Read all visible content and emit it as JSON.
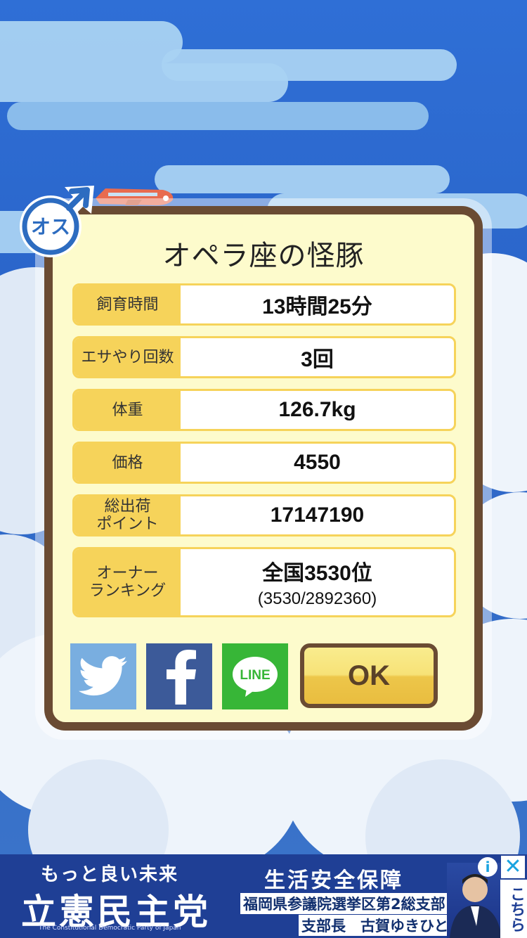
{
  "dialog": {
    "title": "オペラ座の怪豚",
    "rows": [
      {
        "label": "飼育時間",
        "value": "13時間25分"
      },
      {
        "label": "エサやり回数",
        "value": "3回"
      },
      {
        "label": "体重",
        "value": "126.7kg"
      },
      {
        "label": "価格",
        "value": "4550"
      },
      {
        "label": "総出荷\nポイント",
        "value": "17147190"
      },
      {
        "label": "オーナー\nランキング",
        "value": "全国3530位",
        "sub": "(3530/2892360)"
      }
    ],
    "ok_label": "OK",
    "line_label": "LINE"
  },
  "gender_badge": {
    "label": "オス",
    "icon": "male-symbol-icon"
  },
  "colors": {
    "frame": "#6a4b33",
    "panel": "#fdfbcc",
    "label_bg": "#f6d35a",
    "twitter": "#79aee0",
    "facebook": "#3c5a99",
    "line": "#37b637"
  },
  "ad": {
    "left_line1": "もっと良い未来",
    "left_line2": "立憲民主党",
    "left_line3": "The Constitutional Democratic Party of Japan",
    "right_line1": "生活安全保障",
    "right_line2": "福岡県参議院選挙区第2総支部",
    "right_line3": "支部長　古賀ゆきひと",
    "vertical_text": "こちら",
    "info_icon": "i",
    "close_icon": "✕"
  }
}
